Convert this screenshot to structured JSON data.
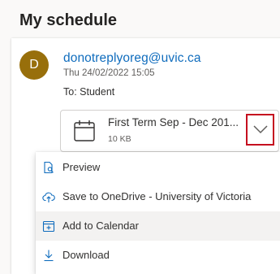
{
  "header": {
    "title": "My schedule"
  },
  "message": {
    "avatar_initial": "D",
    "sender": "donotreplyoreg@uvic.ca",
    "date": "Thu 24/02/2022 15:05",
    "to": "To: Student"
  },
  "attachment": {
    "name": "First Term Sep - Dec 201...",
    "size": "10 KB",
    "icon": "calendar-icon"
  },
  "menu": {
    "items": [
      {
        "label": "Preview",
        "icon": "preview-icon"
      },
      {
        "label": "Save to OneDrive - University of Victoria",
        "icon": "cloud-upload-icon"
      },
      {
        "label": "Add to Calendar",
        "icon": "calendar-add-icon"
      },
      {
        "label": "Download",
        "icon": "download-icon"
      }
    ]
  },
  "colors": {
    "accent": "#0f6cbd",
    "avatar": "#986f0b",
    "highlight_border": "#c50f1f"
  }
}
